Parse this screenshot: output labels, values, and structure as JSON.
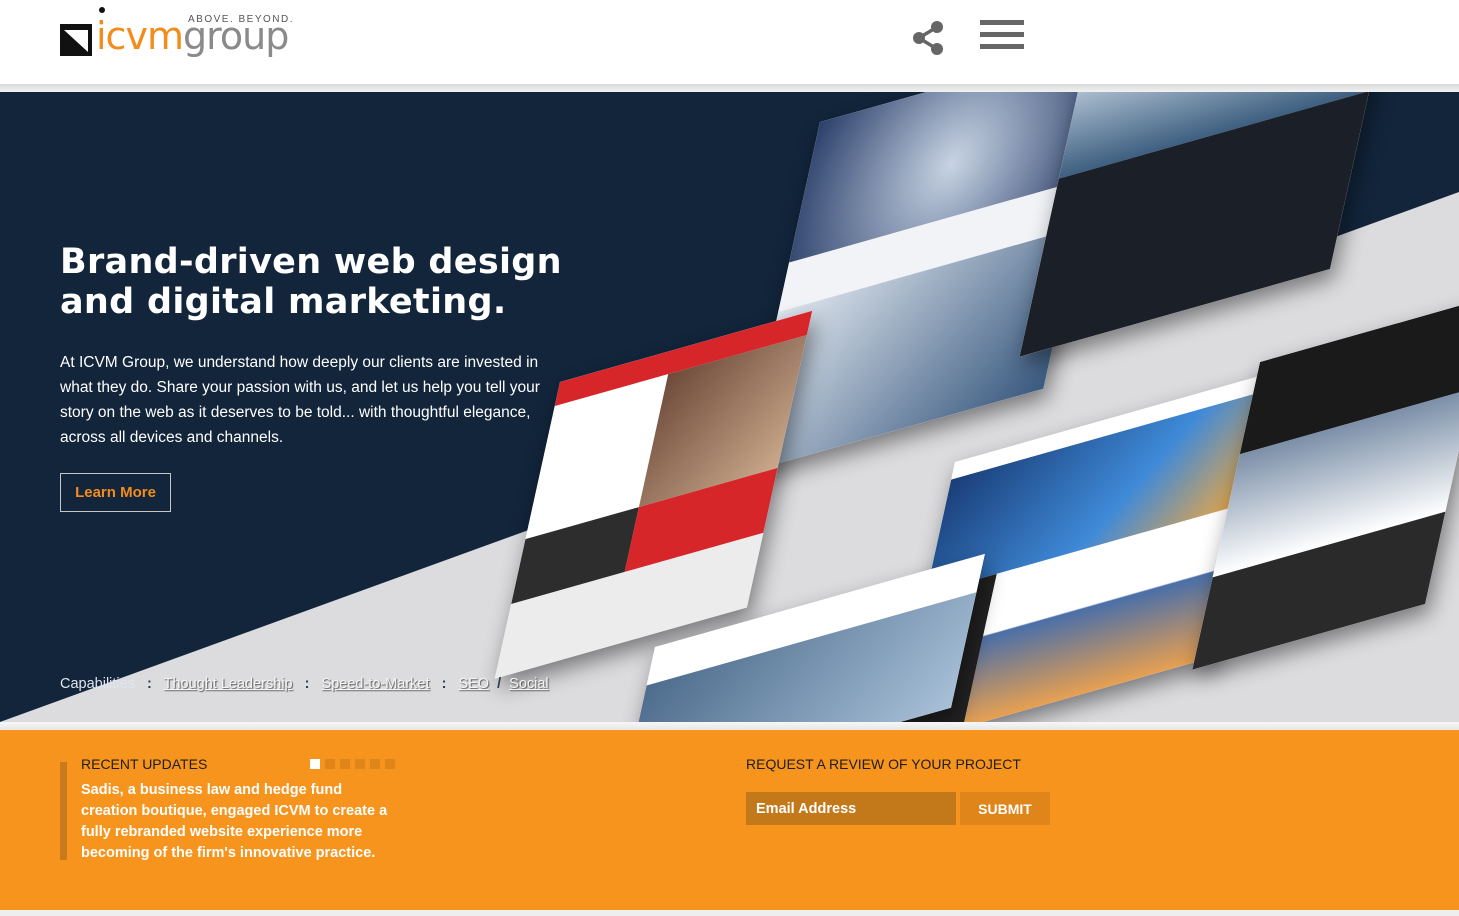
{
  "header": {
    "logo": {
      "brand_a": "icvm",
      "brand_b": "group",
      "tagline": "ABOVE. BEYOND."
    }
  },
  "hero": {
    "title": "Brand-driven web design and digital marketing.",
    "body": "At ICVM Group, we understand how deeply our clients are invested in what they do. Share your passion with us, and let us help you tell your story on the web as it deserves to be told... with thoughtful elegance, across all devices and channels.",
    "cta_label": "Learn More",
    "capabilities": {
      "label": "Capabilities",
      "separator": ":",
      "slash": "/",
      "items": [
        "Thought Leadership",
        "Speed-to-Market",
        "SEO",
        "Social"
      ]
    }
  },
  "updates": {
    "title": "RECENT UPDATES",
    "text": "Sadis, a business law and hedge fund creation boutique, engaged ICVM to create a fully rebranded website experience more becoming of the firm's innovative practice.",
    "pages": 6,
    "active_page": 1
  },
  "review": {
    "title": "REQUEST A REVIEW OF YOUR PROJECT",
    "email_placeholder": "Email Address",
    "submit_label": "SUBMIT"
  },
  "colors": {
    "orange": "#f7941d",
    "navy": "#12253b",
    "brand_orange": "#f28c1c",
    "grey": "#8a8a8a"
  },
  "icons": [
    "logo-mark-icon",
    "share-icon",
    "hamburger-menu-icon"
  ]
}
